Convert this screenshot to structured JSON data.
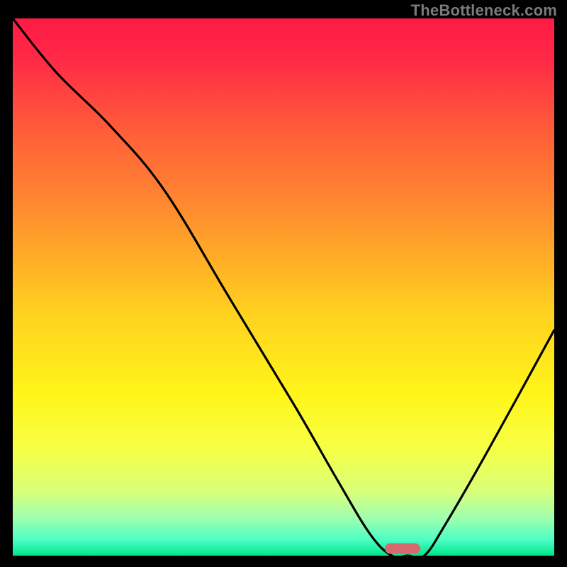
{
  "watermark": "TheBottleneck.com",
  "chart_data": {
    "type": "line",
    "title": "",
    "xlabel": "",
    "ylabel": "",
    "xlim": [
      0,
      100
    ],
    "ylim": [
      0,
      100
    ],
    "x": [
      0,
      8,
      18,
      28,
      40,
      52,
      60,
      66,
      70,
      73,
      76,
      80,
      88,
      100
    ],
    "values": [
      100,
      90,
      80,
      68,
      48,
      28,
      14,
      4,
      0,
      0,
      0,
      6,
      20,
      42
    ],
    "series": [
      {
        "name": "bottleneck-curve",
        "values": [
          100,
          90,
          80,
          68,
          48,
          28,
          14,
          4,
          0,
          0,
          0,
          6,
          20,
          42
        ]
      }
    ],
    "optimal_marker": {
      "x_percent": 72,
      "y_percent": 0,
      "color": "#d76a6f"
    },
    "gradient_stops": [
      {
        "offset": 0.0,
        "color": "#ff1a45"
      },
      {
        "offset": 0.08,
        "color": "#ff2b45"
      },
      {
        "offset": 0.2,
        "color": "#ff5a3a"
      },
      {
        "offset": 0.35,
        "color": "#ff8a2f"
      },
      {
        "offset": 0.55,
        "color": "#ffd21f"
      },
      {
        "offset": 0.7,
        "color": "#fff51a"
      },
      {
        "offset": 0.8,
        "color": "#f7ff45"
      },
      {
        "offset": 0.88,
        "color": "#d9ff7a"
      },
      {
        "offset": 0.93,
        "color": "#9fffae"
      },
      {
        "offset": 0.97,
        "color": "#4dffc4"
      },
      {
        "offset": 1.0,
        "color": "#00e58a"
      }
    ]
  }
}
